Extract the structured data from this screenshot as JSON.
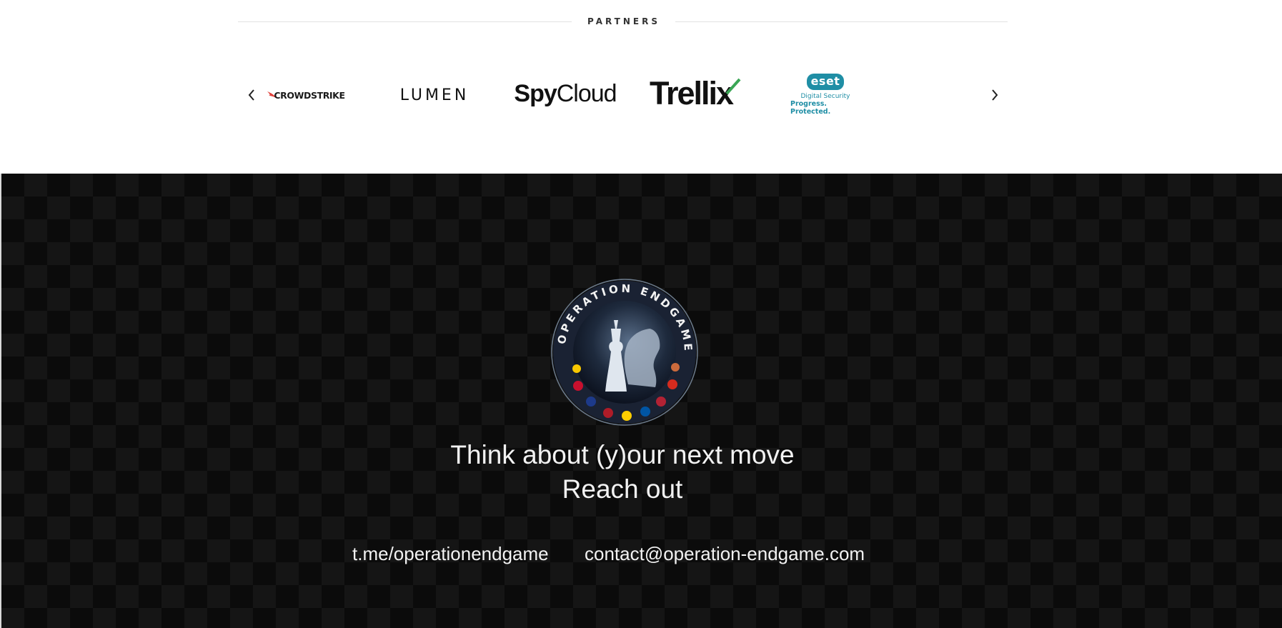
{
  "partners": {
    "title": "PARTNERS",
    "logos": [
      {
        "name": "CrowdStrike",
        "text": "CROWDSTRIKE"
      },
      {
        "name": "Lumen",
        "text": "LUMEN"
      },
      {
        "name": "SpyCloud",
        "text_bold": "Spy",
        "text_light": "Cloud"
      },
      {
        "name": "Trellix",
        "text": "Trellix"
      },
      {
        "name": "ESET",
        "text": "eset",
        "sub1": "Digital Security",
        "sub2": "Progress. Protected."
      }
    ],
    "prev_icon": "chevron-left-icon",
    "next_icon": "chevron-right-icon"
  },
  "footer": {
    "emblem_text": "OPERATION ENDGAME",
    "tagline_line1": "Think about (y)our next move",
    "tagline_line2": "Reach out",
    "telegram": "t.me/operationendgame",
    "email": "contact@operation-endgame.com"
  },
  "colors": {
    "footer_bg": "#0b0b0b",
    "footer_text": "#f2f2f2",
    "eset_teal": "#1f8ea5",
    "trellix_green": "#3aa655"
  }
}
